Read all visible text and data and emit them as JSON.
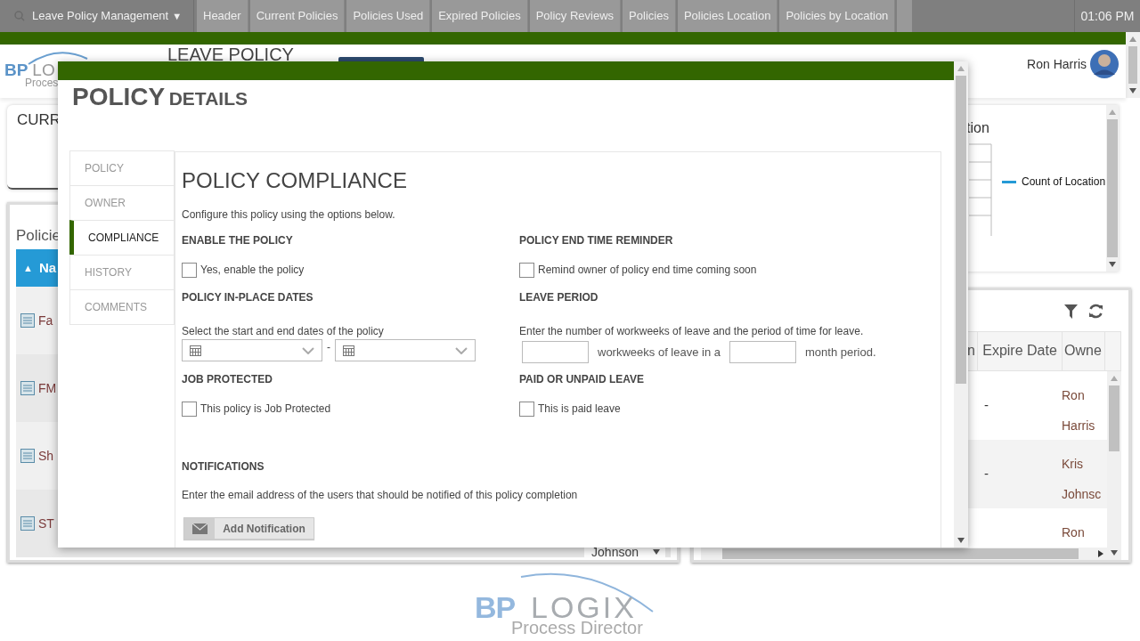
{
  "top_bar": {
    "app_menu": "Leave Policy Management",
    "menu_caret": "▼",
    "tabs": [
      "Header",
      "Current Policies",
      "Policies Used",
      "Expired Policies",
      "Policy Reviews",
      "Policies",
      "Policies Location",
      "Policies by Location"
    ],
    "time": "01:06 PM"
  },
  "header": {
    "logo_brand": "BP",
    "logo_brand_cut": "LO",
    "logo_tagline": "Proces",
    "page_title": "LEAVE POLICY",
    "user_name": "Ron Harris"
  },
  "current_card": {
    "title": "CURR"
  },
  "chart_card": {
    "title": "tion",
    "legend": "Count of Location"
  },
  "policies_panel": {
    "title": "Policie",
    "sort_mark": "▲",
    "column_header": "Na",
    "rows": [
      {
        "name": "Fa"
      },
      {
        "name": "FM"
      },
      {
        "name": "Sh"
      },
      {
        "name": "ST",
        "owner": "Johnson"
      }
    ]
  },
  "table_panel": {
    "columns": [
      "n",
      "Expire Date",
      "Owne"
    ],
    "rows": [
      {
        "expire": "-",
        "owner": "Ron Harris"
      },
      {
        "expire": "-",
        "owner": "Kris Johnsc"
      },
      {
        "expire": "",
        "owner": "Ron"
      }
    ]
  },
  "footer_logo": {
    "brand": "BP",
    "brand_rest": "LOGIX",
    "tagline": "Process Director"
  },
  "modal": {
    "title_main": "POLICY",
    "title_rest": "DETAILS",
    "nav": [
      {
        "label": "POLICY",
        "selected": false
      },
      {
        "label": "OWNER",
        "selected": false
      },
      {
        "label": "COMPLIANCE",
        "selected": true
      },
      {
        "label": "HISTORY",
        "selected": false
      },
      {
        "label": "COMMENTS",
        "selected": false
      }
    ],
    "section_title": "POLICY COMPLIANCE",
    "intro": "Configure this policy using the options below.",
    "groups": [
      {
        "heading": "ENABLE THE POLICY",
        "kind": "checkbox",
        "label": "Yes, enable the policy",
        "checked": false
      },
      {
        "heading": "POLICY END TIME REMINDER",
        "kind": "checkbox",
        "label": "Remind owner of policy end time coming soon",
        "checked": false
      },
      {
        "heading": "POLICY IN-PLACE DATES",
        "kind": "date_range",
        "hint": "Select the start and end dates of the policy",
        "separator": "-"
      },
      {
        "heading": "LEAVE PERIOD",
        "kind": "number_sentence",
        "hint": "Enter the number of workweeks of leave and the period of time for leave.",
        "middle": "workweeks of leave in a",
        "end": "month period."
      },
      {
        "heading": "JOB PROTECTED",
        "kind": "checkbox",
        "label": "This policy is Job Protected",
        "checked": false
      },
      {
        "heading": "PAID OR UNPAID LEAVE",
        "kind": "checkbox",
        "label": "This is paid leave",
        "checked": false
      }
    ],
    "notifications": {
      "heading": "NOTIFICATIONS",
      "hint": "Enter the email address of the users that should be notified of this policy completion",
      "button": "Add Notification"
    }
  }
}
